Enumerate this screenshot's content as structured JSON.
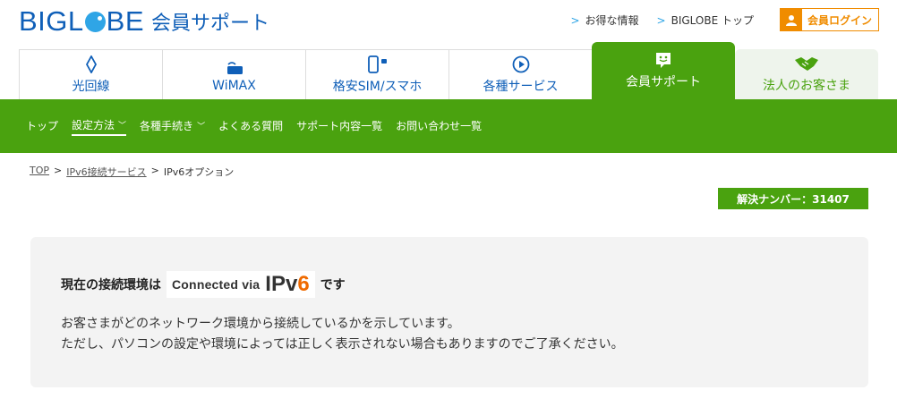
{
  "header": {
    "logo_text_a": "BIGL",
    "logo_text_b": "BE",
    "logo_sub": "会員サポート",
    "links": [
      {
        "chev": ">",
        "label": "お得な情報"
      },
      {
        "chev": ">",
        "label": "BIGLOBE トップ"
      }
    ],
    "login_label": "会員ログイン"
  },
  "mainnav": [
    {
      "label": "光回線",
      "icon": "diamond-icon"
    },
    {
      "label": "WiMAX",
      "icon": "wimax-router-icon"
    },
    {
      "label": "格安SIM/スマホ",
      "icon": "smartphone-icon"
    },
    {
      "label": "各種サービス",
      "icon": "play-circle-icon"
    },
    {
      "label": "会員サポート",
      "icon": "smiley-chat-icon"
    },
    {
      "label": "法人のお客さま",
      "icon": "handshake-icon"
    }
  ],
  "subnav": [
    {
      "label": "トップ",
      "caret": ""
    },
    {
      "label": "設定方法",
      "caret": "﹀"
    },
    {
      "label": "各種手続き",
      "caret": "﹀"
    },
    {
      "label": "よくある質問",
      "caret": ""
    },
    {
      "label": "サポート内容一覧",
      "caret": ""
    },
    {
      "label": "お問い合わせ一覧",
      "caret": ""
    }
  ],
  "breadcrumb": {
    "items": [
      "TOP",
      "IPv6接続サービス",
      "IPv6オプション"
    ],
    "sep": ">"
  },
  "badge": "解決ナンバー：31407",
  "status": {
    "prefix": "現在の接続環境は",
    "via": "Connected via",
    "ipv": "IPv",
    "six": "6",
    "suffix": "です"
  },
  "description": [
    "お客さまがどのネットワーク環境から接続しているかを示しています。",
    "ただし、パソコンの設定や環境によっては正しく表示されない場合もありますのでご了承ください。"
  ],
  "colors": {
    "brand_blue": "#0f5fb8",
    "green": "#4aa20f",
    "orange": "#f08c00"
  }
}
